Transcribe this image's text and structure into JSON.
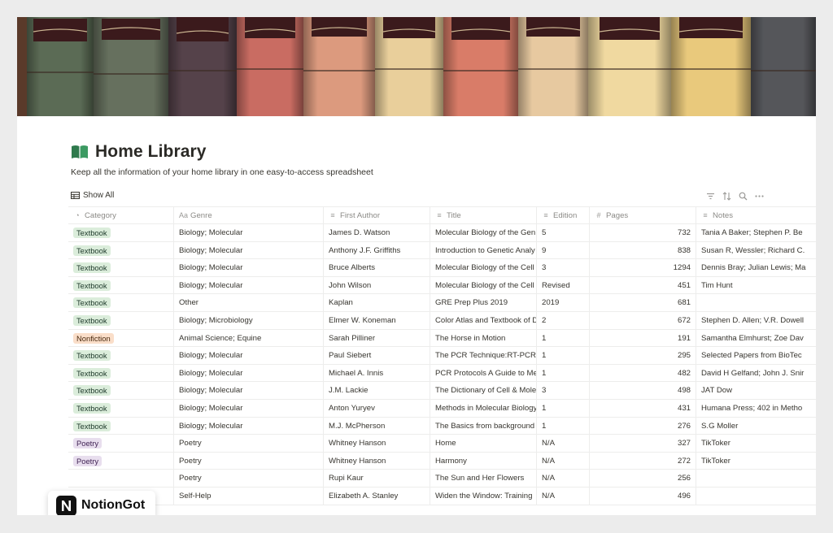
{
  "page": {
    "title": "Home Library",
    "description": "Keep all the information of your home library in one easy-to-access spreadsheet",
    "icon": "open-book-icon"
  },
  "view": {
    "tab_label": "Show All",
    "tools": [
      "filter-icon",
      "sort-icon",
      "search-icon",
      "more-icon"
    ]
  },
  "columns": [
    {
      "label": "Category",
      "icon": "select-icon"
    },
    {
      "label": "Genre",
      "icon": "text-icon"
    },
    {
      "label": "First Author",
      "icon": "text-lines-icon"
    },
    {
      "label": "Title",
      "icon": "text-lines-icon"
    },
    {
      "label": "Edition",
      "icon": "text-lines-icon"
    },
    {
      "label": "Pages",
      "icon": "number-icon"
    },
    {
      "label": "Notes",
      "icon": "text-lines-icon"
    }
  ],
  "rows": [
    {
      "category": "Textbook",
      "genre": "Biology; Molecular",
      "author": "James D. Watson",
      "title": "Molecular Biology of the Gen",
      "edition": "5",
      "pages": "732",
      "notes": "Tania A Baker; Stephen P. Be"
    },
    {
      "category": "Textbook",
      "genre": "Biology; Molecular",
      "author": "Anthony J.F. Griffiths",
      "title": "Introduction to Genetic Analy",
      "edition": "9",
      "pages": "838",
      "notes": "Susan R, Wessler; Richard C."
    },
    {
      "category": "Textbook",
      "genre": "Biology; Molecular",
      "author": "Bruce Alberts",
      "title": "Molecular Biology of the Cell",
      "edition": "3",
      "pages": "1294",
      "notes": "Dennis Bray; Julian Lewis; Ma"
    },
    {
      "category": "Textbook",
      "genre": "Biology; Molecular",
      "author": "John Wilson",
      "title": "Molecular Biology of the Cell",
      "edition": "Revised",
      "pages": "451",
      "notes": "Tim Hunt"
    },
    {
      "category": "Textbook",
      "genre": "Other",
      "author": "Kaplan",
      "title": "GRE Prep Plus 2019",
      "edition": "2019",
      "pages": "681",
      "notes": ""
    },
    {
      "category": "Textbook",
      "genre": "Biology; Microbiology",
      "author": "Elmer W. Koneman",
      "title": "Color Atlas and Textbook of D",
      "edition": "2",
      "pages": "672",
      "notes": "Stephen D. Allen; V.R. Dowell"
    },
    {
      "category": "Nonfiction",
      "genre": "Animal Science; Equine",
      "author": "Sarah Pilliner",
      "title": "The Horse in Motion",
      "edition": "1",
      "pages": "191",
      "notes": "Samantha Elmhurst; Zoe Dav"
    },
    {
      "category": "Textbook",
      "genre": "Biology; Molecular",
      "author": "Paul Siebert",
      "title": "The PCR Technique:RT-PCR",
      "edition": "1",
      "pages": "295",
      "notes": "Selected Papers from BioTec"
    },
    {
      "category": "Textbook",
      "genre": "Biology; Molecular",
      "author": "Michael A. Innis",
      "title": "PCR Protocols A Guide to Me",
      "edition": "1",
      "pages": "482",
      "notes": "David H Gelfand; John J. Snir"
    },
    {
      "category": "Textbook",
      "genre": "Biology; Molecular",
      "author": "J.M. Lackie",
      "title": "The Dictionary of Cell & Mole",
      "edition": "3",
      "pages": "498",
      "notes": "JAT Dow"
    },
    {
      "category": "Textbook",
      "genre": "Biology; Molecular",
      "author": "Anton Yuryev",
      "title": "Methods in Molecular Biology",
      "edition": "1",
      "pages": "431",
      "notes": "Humana Press; 402 in Metho"
    },
    {
      "category": "Textbook",
      "genre": "Biology; Molecular",
      "author": "M.J. McPherson",
      "title": "The Basics from background",
      "edition": "1",
      "pages": "276",
      "notes": "S.G Moller"
    },
    {
      "category": "Poetry",
      "genre": "Poetry",
      "author": "Whitney Hanson",
      "title": "Home",
      "edition": "N/A",
      "pages": "327",
      "notes": "TikToker"
    },
    {
      "category": "Poetry",
      "genre": "Poetry",
      "author": "Whitney Hanson",
      "title": "Harmony",
      "edition": "N/A",
      "pages": "272",
      "notes": "TikToker"
    },
    {
      "category": "",
      "genre": "Poetry",
      "author": "Rupi Kaur",
      "title": "The Sun and Her Flowers",
      "edition": "N/A",
      "pages": "256",
      "notes": ""
    },
    {
      "category": "",
      "genre": "Self-Help",
      "author": "Elizabeth A. Stanley",
      "title": "Widen the Window: Training",
      "edition": "N/A",
      "pages": "496",
      "notes": ""
    }
  ],
  "watermark": {
    "brand": "NotionGot"
  },
  "colors": {
    "textbook_tag": "#dbeddb",
    "nonfiction_tag": "#fadec9",
    "poetry_tag": "#e8deee"
  }
}
